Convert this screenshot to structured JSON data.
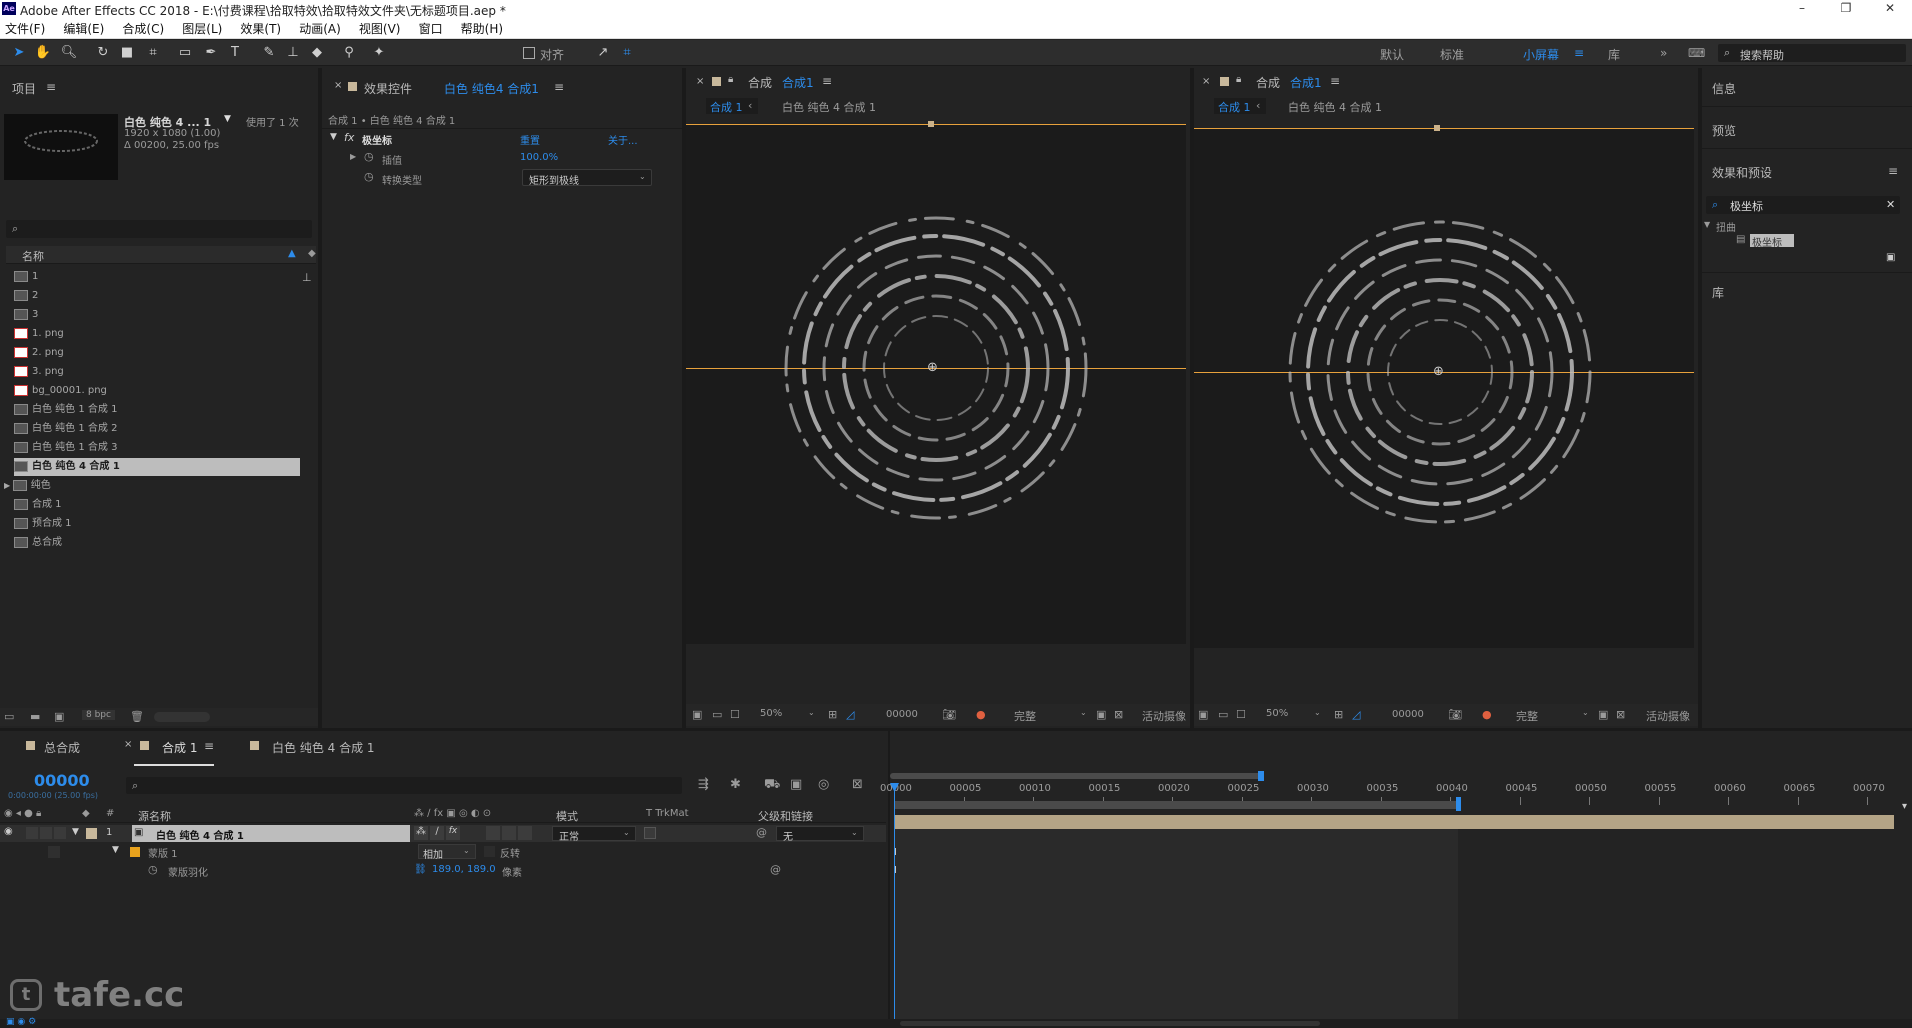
{
  "window": {
    "title": "Adobe After Effects CC 2018 - E:\\付费课程\\拾取特效\\拾取特效文件夹\\无标题项目.aep *",
    "app_icon": "Ae"
  },
  "menu": [
    "文件(F)",
    "编辑(E)",
    "合成(C)",
    "图层(L)",
    "效果(T)",
    "动画(A)",
    "视图(V)",
    "窗口",
    "帮助(H)"
  ],
  "toolbar": {
    "align_label": "对齐",
    "workspaces": [
      "默认",
      "标准",
      "小屏幕",
      "库"
    ],
    "active_workspace": "小屏幕",
    "search_placeholder": "搜索帮助"
  },
  "project": {
    "title": "项目",
    "selected_name": "白色 纯色 4 ... 1",
    "used": "使用了 1 次",
    "dims": "1920 x 1080 (1.00)",
    "duration": "Δ 00200, 25.00 fps",
    "col_name": "名称",
    "items": [
      {
        "name": "1",
        "kind": "comp"
      },
      {
        "name": "2",
        "kind": "comp"
      },
      {
        "name": "3",
        "kind": "comp"
      },
      {
        "name": "1. png",
        "kind": "png"
      },
      {
        "name": "2. png",
        "kind": "png"
      },
      {
        "name": "3. png",
        "kind": "png"
      },
      {
        "name": "bg_00001. png",
        "kind": "png"
      },
      {
        "name": "白色 纯色 1 合成 1",
        "kind": "comp"
      },
      {
        "name": "白色 纯色 1 合成 2",
        "kind": "comp"
      },
      {
        "name": "白色 纯色 1 合成 3",
        "kind": "comp"
      },
      {
        "name": "白色 纯色 4 合成 1",
        "kind": "comp",
        "selected": true
      },
      {
        "name": "纯色",
        "kind": "folder"
      },
      {
        "name": "合成 1",
        "kind": "comp"
      },
      {
        "name": "预合成 1",
        "kind": "comp"
      },
      {
        "name": "总合成",
        "kind": "comp"
      }
    ],
    "bpc": "8 bpc"
  },
  "effects_controls": {
    "title_prefix": "效果控件",
    "title_layer": "白色 纯色4 合成1",
    "breadcrumb": "合成 1 • 白色 纯色 4 合成 1",
    "effect_name": "极坐标",
    "reset": "重置",
    "about": "关于...",
    "prop1_label": "插值",
    "prop1_value": "100.0%",
    "prop2_label": "转换类型",
    "prop2_value": "矩形到极线"
  },
  "viewer_left": {
    "title_prefix": "合成",
    "comp_name": "合成1",
    "tab_active": "合成 1",
    "tab_other": "白色 纯色 4 合成 1",
    "zoom": "50%",
    "time": "00000",
    "quality": "完整",
    "camera": "活动摄像"
  },
  "viewer_right": {
    "title_prefix": "合成",
    "comp_name": "合成1",
    "tab_active": "合成 1",
    "tab_other": "白色 纯色 4 合成 1",
    "zoom": "50%",
    "time": "00000",
    "quality": "完整",
    "camera": "活动摄像"
  },
  "right_panels": {
    "info": "信息",
    "preview": "预览",
    "effects_presets": "效果和预设",
    "search_value": "极坐标",
    "category": "扭曲",
    "effect_item": "极坐标",
    "library": "库"
  },
  "timeline": {
    "tabs": [
      "总合成",
      "合成 1",
      "白色 纯色 4 合成 1"
    ],
    "active_tab": "合成 1",
    "timecode": "00000",
    "timecode_sub": "0:00:00:00 (25.00 fps)",
    "col_source": "源名称",
    "col_mode": "模式",
    "col_trkmat": "T  TrkMat",
    "col_parent": "父级和链接",
    "layer_num": "1",
    "layer_name": "白色 纯色 4 合成 1",
    "layer_mode": "正常",
    "layer_parent": "无",
    "mask_name": "蒙版 1",
    "mask_mode": "相加",
    "mask_invert": "反转",
    "feather_label": "蒙版羽化",
    "feather_value": "189.0, 189.0",
    "feather_unit": "像素",
    "ruler": [
      "00000",
      "00005",
      "00010",
      "00015",
      "00020",
      "00025",
      "00030",
      "00035",
      "00040",
      "00045",
      "00050",
      "00055",
      "00060",
      "00065",
      "00070"
    ]
  },
  "watermark": "tafe.cc",
  "colors": {
    "accent": "#2d8ceb",
    "guide": "#e7a13c",
    "layer_bar": "#b4a486",
    "selected_row": "#bdbdbd"
  }
}
